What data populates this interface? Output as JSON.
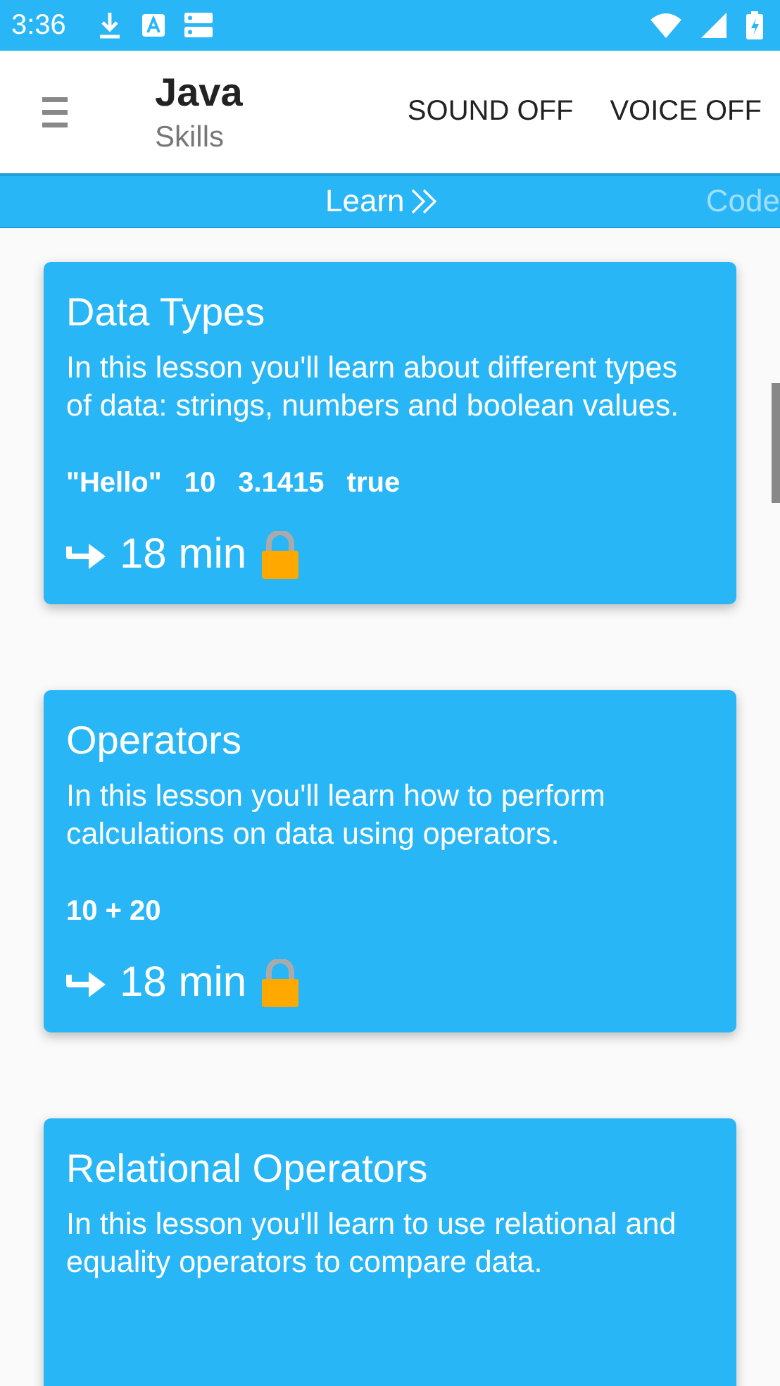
{
  "status_bar": {
    "time": "3:36"
  },
  "app_bar": {
    "title": "Java",
    "subtitle": "Skills",
    "actions": [
      "SOUND OFF",
      "VOICE OFF"
    ]
  },
  "tabs": [
    {
      "label": "Learn",
      "selected": true
    },
    {
      "label": "Code",
      "selected": false
    }
  ],
  "lessons": [
    {
      "title": "Data Types",
      "description": "In this lesson you'll learn about different types of data: strings, numbers and boolean values.",
      "examples": [
        "\"Hello\"",
        "10",
        "3.1415",
        "true"
      ],
      "duration": "18 min",
      "locked": true
    },
    {
      "title": "Operators",
      "description": "In this lesson you'll learn how to perform calculations on data using operators.",
      "examples": [
        "10 + 20"
      ],
      "duration": "18 min",
      "locked": true
    },
    {
      "title": "Relational Operators",
      "description": "In this lesson you'll learn to use relational and equality operators to compare data."
    }
  ]
}
